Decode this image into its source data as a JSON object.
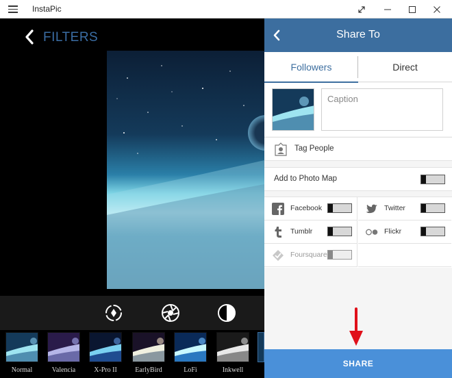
{
  "window": {
    "title": "InstaPic"
  },
  "editor": {
    "section_title": "FILTERS",
    "tools": [
      "rotate-icon",
      "lux-icon",
      "contrast-icon"
    ],
    "filters": [
      {
        "name": "Normal"
      },
      {
        "name": "Valencia"
      },
      {
        "name": "X-Pro II"
      },
      {
        "name": "EarlyBird"
      },
      {
        "name": "LoFi"
      },
      {
        "name": "Inkwell"
      }
    ]
  },
  "share": {
    "title": "Share To",
    "tabs": [
      {
        "label": "Followers",
        "active": true
      },
      {
        "label": "Direct",
        "active": false
      }
    ],
    "caption_placeholder": "Caption",
    "tag_people_label": "Tag People",
    "photo_map_label": "Add to Photo Map",
    "services": [
      {
        "name": "Facebook",
        "icon": "facebook-icon",
        "enabled": true
      },
      {
        "name": "Twitter",
        "icon": "twitter-icon",
        "enabled": true
      },
      {
        "name": "Tumblr",
        "icon": "tumblr-icon",
        "enabled": true
      },
      {
        "name": "Flickr",
        "icon": "flickr-icon",
        "enabled": true
      },
      {
        "name": "Foursquare",
        "icon": "foursquare-icon",
        "enabled": false
      }
    ],
    "share_button": "SHARE"
  },
  "colors": {
    "accent": "#3c6e9f",
    "share_button": "#4a90d9",
    "arrow": "#e0101a"
  }
}
